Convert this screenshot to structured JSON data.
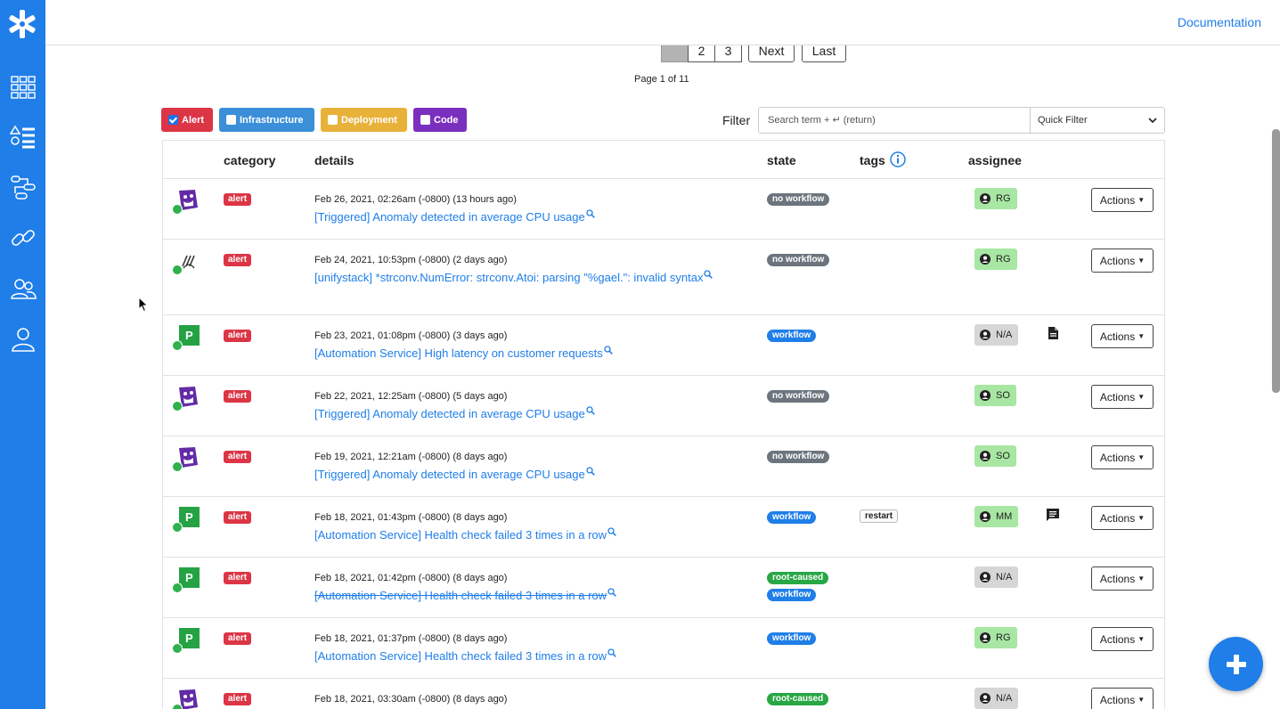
{
  "topbar": {
    "documentation_label": "Documentation"
  },
  "sidebar": {
    "icons": [
      "logo-icon",
      "dashboard-grid-icon",
      "alert-list-icon",
      "workflow-icon",
      "integrations-link-icon",
      "team-icon",
      "user-icon"
    ]
  },
  "pagination": {
    "pages": [
      "1",
      "2",
      "3"
    ],
    "next_label": "Next",
    "last_label": "Last",
    "info": "Page 1 of 11"
  },
  "category_filters": [
    {
      "label": "Alert",
      "checked": true,
      "color": "#dc3545"
    },
    {
      "label": "Infrastructure",
      "checked": false,
      "color": "#3b8fd9"
    },
    {
      "label": "Deployment",
      "checked": false,
      "color": "#e8b23a"
    },
    {
      "label": "Code",
      "checked": false,
      "color": "#7b2fbe"
    }
  ],
  "filter": {
    "label": "Filter",
    "placeholder": "Search term + ↵ (return)",
    "quick_filter_label": "Quick Filter"
  },
  "table": {
    "headers": {
      "category": "category",
      "details": "details",
      "state": "state",
      "tags": "tags",
      "assignee": "assignee"
    },
    "rows": [
      {
        "source": "datadog",
        "category": "alert",
        "time": "Feb 26, 2021, 02:26am (-0800) (13 hours ago)",
        "title": "[Triggered] Anomaly detected in average CPU usage",
        "struck": false,
        "states": [
          "no workflow"
        ],
        "tag": "",
        "assignee": "RG",
        "assignee_style": "green",
        "note": "",
        "actions": "Actions"
      },
      {
        "source": "signal",
        "category": "alert",
        "time": "Feb 24, 2021, 10:53pm (-0800) (2 days ago)",
        "title": "[unifystack] *strconv.NumError: strconv.Atoi: parsing \"%gael.\": invalid syntax",
        "struck": false,
        "states": [
          "no workflow"
        ],
        "tag": "",
        "assignee": "RG",
        "assignee_style": "green",
        "note": "",
        "actions": "Actions"
      },
      {
        "source": "pagerduty",
        "category": "alert",
        "time": "Feb 23, 2021, 01:08pm (-0800) (3 days ago)",
        "title": "[Automation Service] High latency on customer requests",
        "struck": false,
        "states": [
          "workflow"
        ],
        "tag": "",
        "assignee": "N/A",
        "assignee_style": "gray",
        "note": "document",
        "actions": "Actions"
      },
      {
        "source": "datadog",
        "category": "alert",
        "time": "Feb 22, 2021, 12:25am (-0800) (5 days ago)",
        "title": "[Triggered] Anomaly detected in average CPU usage",
        "struck": false,
        "states": [
          "no workflow"
        ],
        "tag": "",
        "assignee": "SO",
        "assignee_style": "green",
        "note": "",
        "actions": "Actions"
      },
      {
        "source": "datadog",
        "category": "alert",
        "time": "Feb 19, 2021, 12:21am (-0800) (8 days ago)",
        "title": "[Triggered] Anomaly detected in average CPU usage",
        "struck": false,
        "states": [
          "no workflow"
        ],
        "tag": "",
        "assignee": "SO",
        "assignee_style": "green",
        "note": "",
        "actions": "Actions"
      },
      {
        "source": "pagerduty",
        "category": "alert",
        "time": "Feb 18, 2021, 01:43pm (-0800) (8 days ago)",
        "title": "[Automation Service] Health check failed 3 times in a row",
        "struck": false,
        "states": [
          "workflow"
        ],
        "tag": "restart",
        "assignee": "MM",
        "assignee_style": "green",
        "note": "comment",
        "actions": "Actions"
      },
      {
        "source": "pagerduty",
        "category": "alert",
        "time": "Feb 18, 2021, 01:42pm (-0800) (8 days ago)",
        "title": "[Automation Service] Health check failed 3 times in a row",
        "struck": true,
        "states": [
          "root-caused",
          "workflow"
        ],
        "tag": "",
        "assignee": "N/A",
        "assignee_style": "gray",
        "note": "",
        "actions": "Actions"
      },
      {
        "source": "pagerduty",
        "category": "alert",
        "time": "Feb 18, 2021, 01:37pm (-0800) (8 days ago)",
        "title": "[Automation Service] Health check failed 3 times in a row",
        "struck": false,
        "states": [
          "workflow"
        ],
        "tag": "",
        "assignee": "RG",
        "assignee_style": "green",
        "note": "",
        "actions": "Actions"
      },
      {
        "source": "datadog",
        "category": "alert",
        "time": "Feb 18, 2021, 03:30am (-0800) (8 days ago)",
        "title": "",
        "struck": false,
        "states": [
          "root-caused"
        ],
        "tag": "",
        "assignee": "N/A",
        "assignee_style": "gray",
        "note": "",
        "actions": "Actions"
      }
    ]
  },
  "fab": {
    "icon": "plus-icon"
  }
}
